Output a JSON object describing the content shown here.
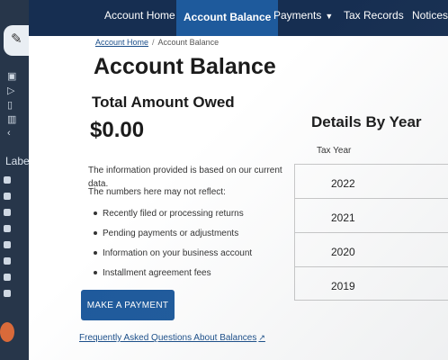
{
  "nav": {
    "items": [
      {
        "label": "Account Home",
        "active": false
      },
      {
        "label": "Account Balance",
        "active": true
      },
      {
        "label": "Payments",
        "active": false
      },
      {
        "label": "Tax Records",
        "active": false
      },
      {
        "label": "Notices a",
        "active": false
      }
    ]
  },
  "breadcrumb": {
    "home": "Account Home",
    "separator": "/",
    "current": "Account Balance"
  },
  "page": {
    "title": "Account Balance",
    "owed_label": "Total Amount Owed",
    "owed_value": "$0.00",
    "info_text": "The information provided is based on our current data.",
    "reflect_text": "The numbers here may not reflect:",
    "bullets": [
      "Recently filed or processing returns",
      "Pending payments or adjustments",
      "Information on your business account",
      "Installment agreement fees"
    ],
    "pay_button": "MAKE A PAYMENT",
    "faq_link": "Frequently Asked Questions About Balances"
  },
  "details": {
    "title": "Details By Year",
    "column_header": "Tax Year",
    "years": [
      "2022",
      "2021",
      "2020",
      "2019"
    ]
  },
  "background_app": {
    "labels_heading": "Labels"
  },
  "colors": {
    "nav_bg": "#162e51",
    "nav_active": "#1e5a9c",
    "button": "#1e5a9c",
    "link": "#1a4e8a"
  }
}
